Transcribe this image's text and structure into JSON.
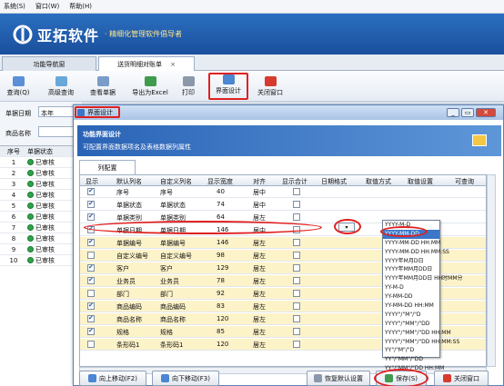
{
  "menu": [
    "系统(S)",
    "窗口(W)",
    "帮助(H)"
  ],
  "banner": {
    "brand": "亚拓软件",
    "slogan": "· 精细化管理软件倡导者"
  },
  "tabs": [
    {
      "label": "功能导航窗",
      "active": false
    },
    {
      "label": "送货明细对账单",
      "active": true
    }
  ],
  "tab_close": "×",
  "toolbar": {
    "query": "查询(Q)",
    "advanced": "高级查询",
    "view_doc": "查看单据",
    "export": "导出为Excel",
    "print": "打印",
    "ui_design": "界面设计",
    "close": "关闭窗口"
  },
  "filter": {
    "date_label": "单据日期",
    "date_value": "本年",
    "product_label": "商品名称"
  },
  "main_grid": {
    "headers": [
      "序号",
      "单据状态"
    ],
    "rows": [
      {
        "no": "1",
        "status": "已审核"
      },
      {
        "no": "2",
        "status": "已审核"
      },
      {
        "no": "3",
        "status": "已审核"
      },
      {
        "no": "4",
        "status": "已审核"
      },
      {
        "no": "5",
        "status": "已审核"
      },
      {
        "no": "6",
        "status": "已审核"
      },
      {
        "no": "7",
        "status": "已审核"
      },
      {
        "no": "8",
        "status": "已审核"
      },
      {
        "no": "9",
        "status": "已审核"
      },
      {
        "no": "10",
        "status": "已审核"
      }
    ]
  },
  "dialog": {
    "title": "界面设计",
    "header_title": "功能界面设计",
    "header_subtitle": "可配置界面数据项名及表格数据列属性",
    "subtab": "列配置",
    "columns": [
      "显示",
      "默认列名",
      "自定义列名",
      "显示宽度",
      "对齐",
      "显示合计",
      "日期格式",
      "取值方式",
      "取值设置",
      "可查询"
    ],
    "rows": [
      {
        "show": true,
        "default": "序号",
        "custom": "序号",
        "width": "40",
        "align": "居中",
        "yellow": false
      },
      {
        "show": true,
        "default": "单据状态",
        "custom": "单据状态",
        "width": "74",
        "align": "居中",
        "yellow": false
      },
      {
        "show": true,
        "default": "单据类别",
        "custom": "单据类别",
        "width": "64",
        "align": "居左",
        "yellow": false
      },
      {
        "show": true,
        "default": "单据日期",
        "custom": "单据日期",
        "width": "146",
        "align": "居中",
        "yellow": false
      },
      {
        "show": true,
        "default": "单据编号",
        "custom": "单据编号",
        "width": "146",
        "align": "居左",
        "yellow": true
      },
      {
        "show": false,
        "default": "自定义编号",
        "custom": "自定义编号",
        "width": "98",
        "align": "居左",
        "yellow": true
      },
      {
        "show": true,
        "default": "客户",
        "custom": "客户",
        "width": "129",
        "align": "居左",
        "yellow": true
      },
      {
        "show": true,
        "default": "业务员",
        "custom": "业务员",
        "width": "78",
        "align": "居左",
        "yellow": true
      },
      {
        "show": false,
        "default": "部门",
        "custom": "部门",
        "width": "92",
        "align": "居左",
        "yellow": true
      },
      {
        "show": true,
        "default": "商品编码",
        "custom": "商品编码",
        "width": "83",
        "align": "居左",
        "yellow": true
      },
      {
        "show": true,
        "default": "商品名称",
        "custom": "商品名称",
        "width": "120",
        "align": "居左",
        "yellow": true
      },
      {
        "show": true,
        "default": "规格",
        "custom": "规格",
        "width": "85",
        "align": "居左",
        "yellow": true
      },
      {
        "show": false,
        "default": "条形码1",
        "custom": "条形码1",
        "width": "120",
        "align": "居左",
        "yellow": true
      }
    ],
    "date_formats": [
      "YYYY-M-D",
      "YYYY-MM-DD",
      "YYYY-MM-DD HH:MM",
      "YYYY-MM-DD HH:MM:SS",
      "YYYY年M月D日",
      "YYYY年MM月DD日",
      "YYYY年MM月DD日 HH时MM分",
      "YY-M-D",
      "YY-MM-DD",
      "YY-MM-DD HH:MM",
      "YYYY\"/\"M\"/\"D",
      "YYYY\"/\"MM\"/\"DD",
      "YYYY\"/\"MM\"/\"DD HH:MM",
      "YYYY\"/\"MM\"/\"DD HH:MM:SS",
      "YY\"/\"M\"/\"D",
      "YY\"/\"MM\"/\"DD",
      "YY\"/\"MM\"/\"DD HH:MM"
    ],
    "buttons": {
      "move_up": "向上移动(F2)",
      "move_down": "向下移动(F3)",
      "restore": "恢复默认设置",
      "save": "保存(S)",
      "close": "关闭窗口"
    }
  },
  "colors": {
    "banner": "#1f5aa8",
    "accent_red": "#e02020",
    "status_green": "#2da34a",
    "row_yellow": "#fdf3c9"
  }
}
